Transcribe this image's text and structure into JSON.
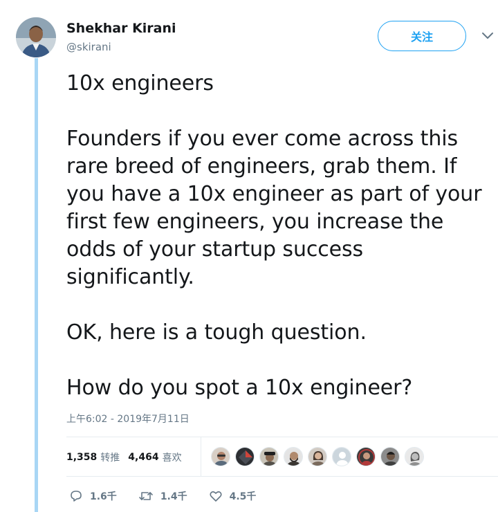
{
  "author": {
    "name": "Shekhar Kirani",
    "handle": "@skirani"
  },
  "follow_button_label": "关注",
  "tweet": {
    "text": "10x engineers\n\nFounders if you ever come across this\nrare breed of engineers, grab them. If\nyou have a 10x engineer as part of your\nfirst few engineers, you increase the\nodds of your startup success\nsignificantly.\n\nOK, here is a tough question.\n\nHow do you spot a 10x engineer?",
    "timestamp": "上午6:02 - 2019年7月11日"
  },
  "stats": {
    "retweets_count": "1,358",
    "retweets_label": "转推",
    "likes_count": "4,464",
    "likes_label": "喜欢"
  },
  "likers": [
    {
      "icon": "avatar-man-glasses",
      "color": "#b0826a"
    },
    {
      "icon": "avatar-dark-logo",
      "color": "#2d2f33"
    },
    {
      "icon": "avatar-man-hat",
      "color": "#55514a"
    },
    {
      "icon": "avatar-man-beard",
      "color": "#3a3632"
    },
    {
      "icon": "avatar-woman-dark-hair",
      "color": "#7a6a5c"
    },
    {
      "icon": "avatar-default-egg",
      "color": "#ccd6dd"
    },
    {
      "icon": "avatar-woman-red",
      "color": "#b23a3a"
    },
    {
      "icon": "avatar-man-dark",
      "color": "#3f3f3f"
    },
    {
      "icon": "avatar-woman-light",
      "color": "#8f8f8f"
    }
  ],
  "actions": {
    "replies": "1.6千",
    "retweets": "1.4千",
    "likes": "4.5千"
  },
  "colors": {
    "accent": "#1da1f2",
    "thread_line": "#a8d6f5",
    "secondary_text": "#657786"
  }
}
